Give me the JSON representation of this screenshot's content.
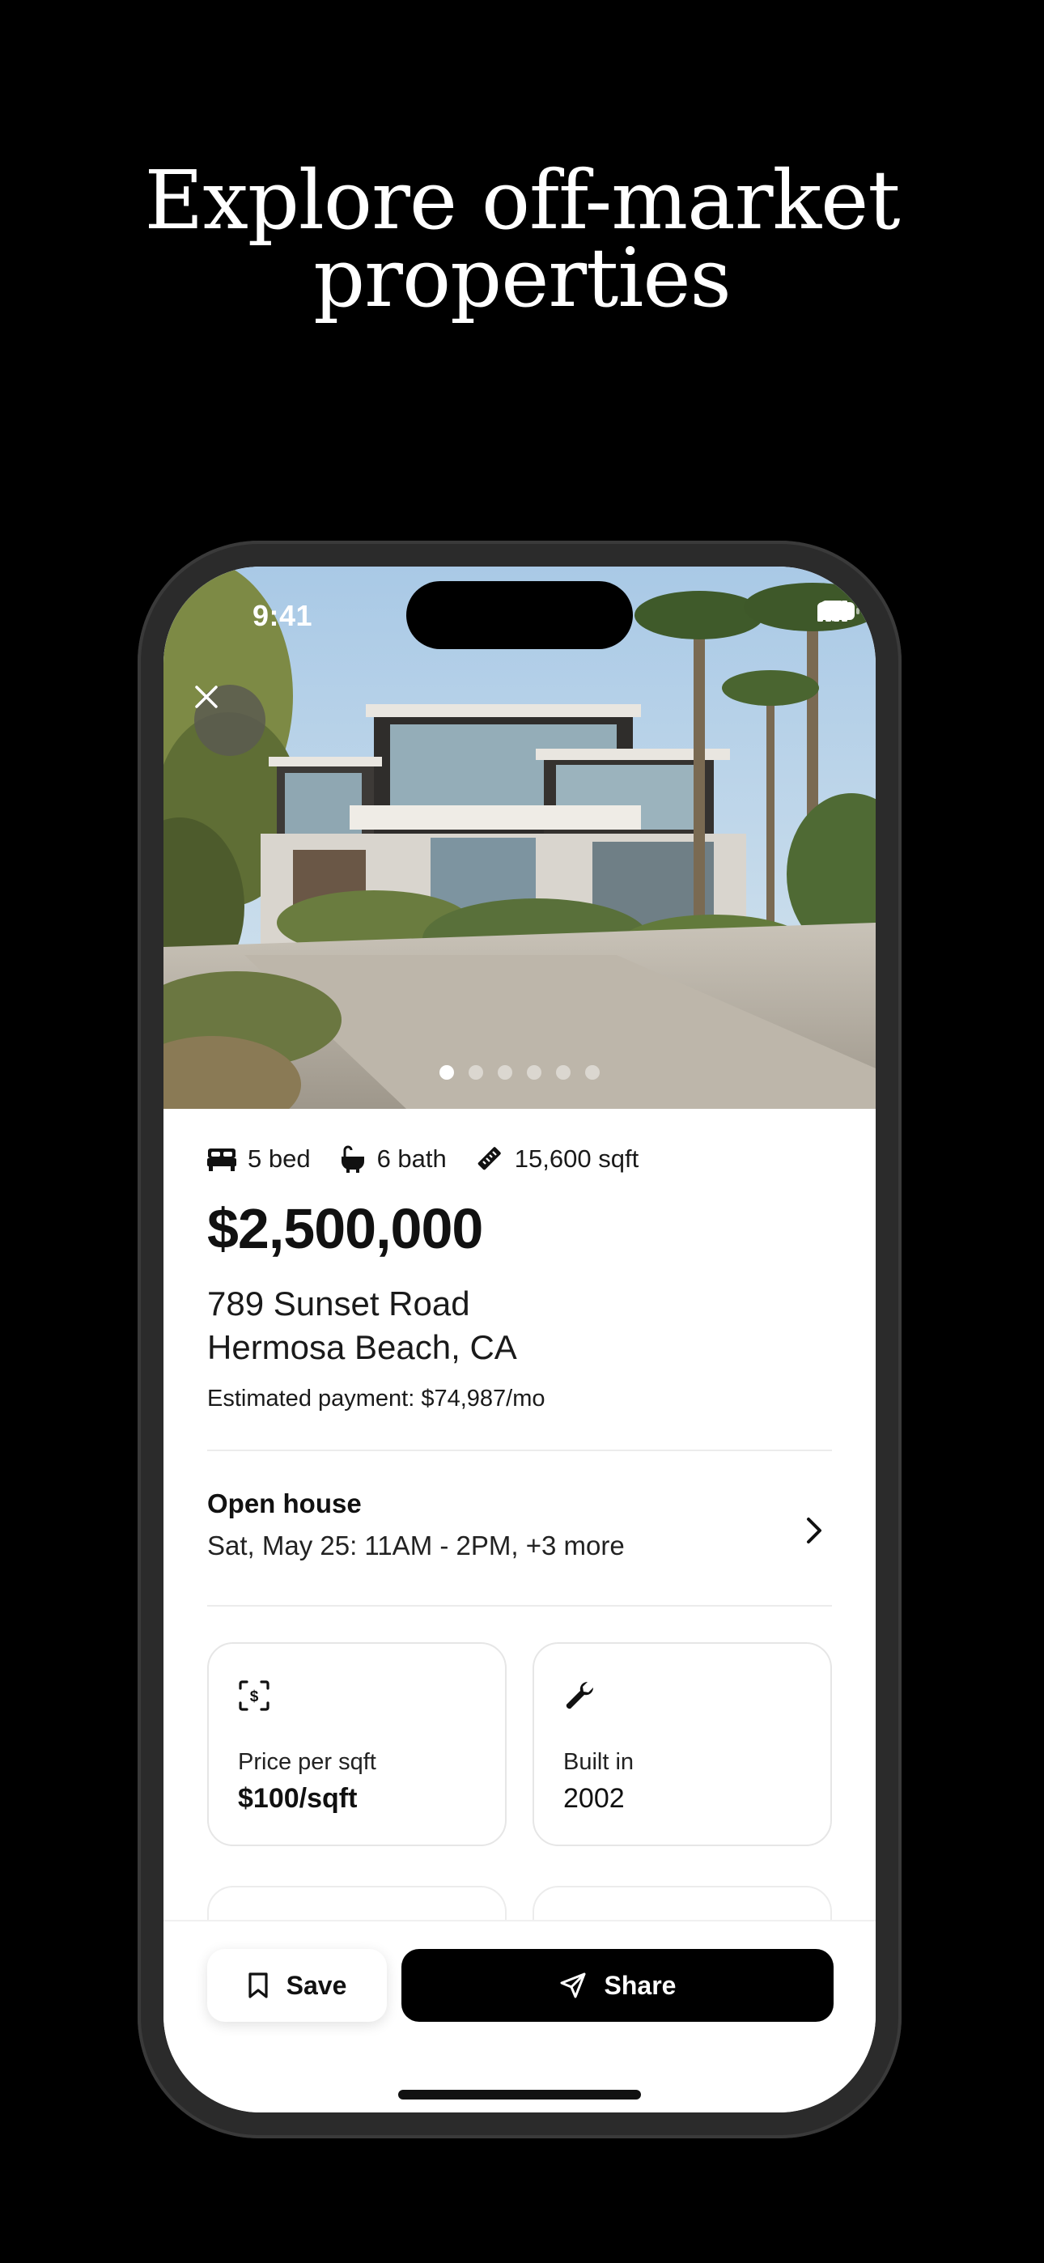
{
  "headline": {
    "line1": "Explore off-market",
    "line2": "properties"
  },
  "status_bar": {
    "time": "9:41"
  },
  "gallery": {
    "image_count": 6,
    "active_index": 0
  },
  "specs": {
    "beds": "5 bed",
    "baths": "6 bath",
    "sqft": "15,600 sqft"
  },
  "listing": {
    "price": "$2,500,000",
    "address_line1": "789 Sunset Road",
    "address_line2": "Hermosa Beach, CA",
    "estimated_payment": "Estimated payment: $74,987/mo"
  },
  "open_house": {
    "title": "Open house",
    "times": "Sat, May 25: 11AM - 2PM, +3 more"
  },
  "facts": [
    {
      "label": "Price per sqft",
      "value": "$100/sqft",
      "icon": "dollar-scan-icon"
    },
    {
      "label": "Built in",
      "value": "2002",
      "icon": "wrench-icon"
    }
  ],
  "actions": {
    "save_label": "Save",
    "share_label": "Share"
  },
  "colors": {
    "background": "#000000",
    "primary_button": "#000000",
    "surface": "#ffffff"
  }
}
